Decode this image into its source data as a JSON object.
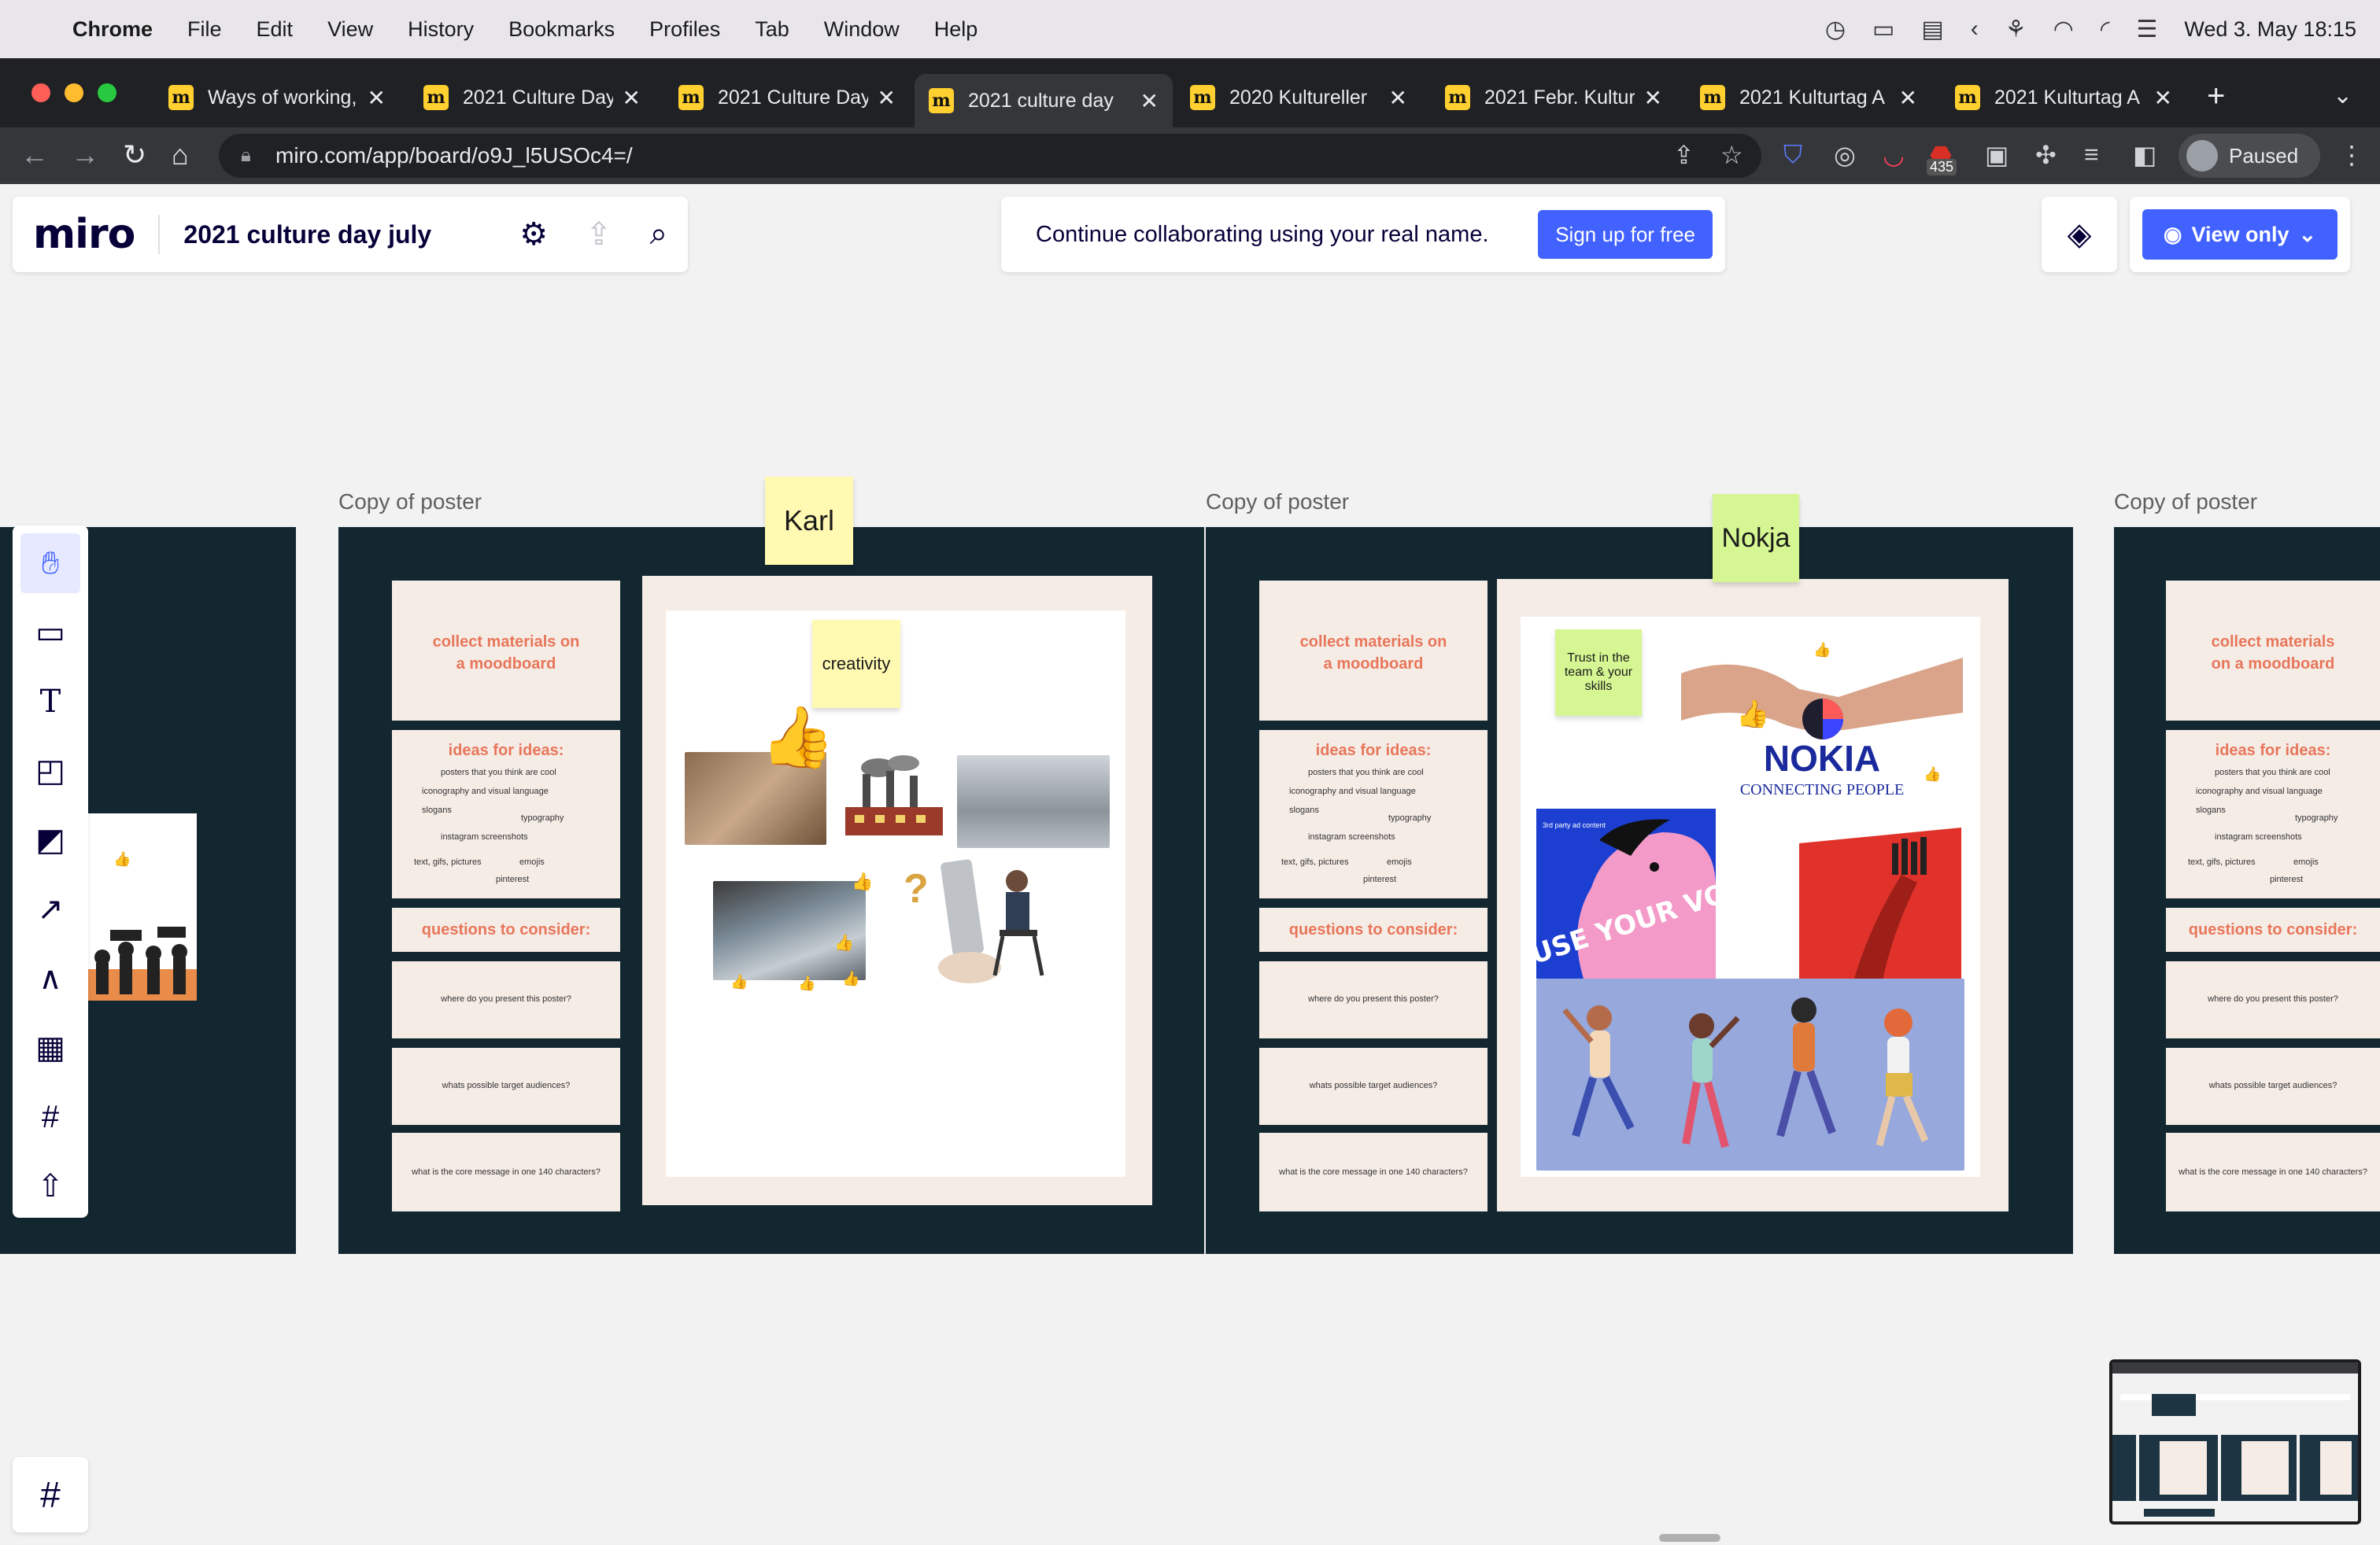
{
  "menubar": {
    "app": "Chrome",
    "items": [
      "File",
      "Edit",
      "View",
      "History",
      "Bookmarks",
      "Profiles",
      "Tab",
      "Window",
      "Help"
    ],
    "datetime": "Wed 3. May  18:15"
  },
  "browser": {
    "tabs": [
      {
        "title": "Ways of working,",
        "active": false
      },
      {
        "title": "2021 Culture Day",
        "active": false
      },
      {
        "title": "2021 Culture Day",
        "active": false
      },
      {
        "title": "2021 culture day",
        "active": true
      },
      {
        "title": "2020 Kultureller",
        "active": false
      },
      {
        "title": "2021 Febr. Kultur",
        "active": false
      },
      {
        "title": "2021 Kulturtag A",
        "active": false
      },
      {
        "title": "2021 Kulturtag A",
        "active": false
      }
    ],
    "url": "miro.com/app/board/o9J_l5USOc4=/",
    "profile_label": "Paused",
    "badge_count": "435"
  },
  "miro": {
    "logo": "miro",
    "board_name": "2021 culture day july",
    "banner_text": "Continue collaborating using your real name.",
    "signup_label": "Sign up for free",
    "view_only_label": "View only"
  },
  "canvas": {
    "frame_label": "Copy of poster",
    "panels": {
      "collect": "collect materials on a moodboard",
      "ideas_title": "ideas for ideas:",
      "ideas_items": [
        "posters that you think are cool",
        "iconography and visual language",
        "slogans",
        "typography",
        "instagram screenshots",
        "text, gifs, pictures",
        "emojis",
        "pinterest"
      ],
      "questions_title": "questions to consider:",
      "q1": "where do you present this poster?",
      "q2": "whats possible target audiences?",
      "q3": "what is the core message in one 140 characters?"
    },
    "stickies": {
      "karl": "Karl",
      "creativity": "creativity",
      "nokja": "Nokja",
      "trust": "Trust in the team & your skills"
    },
    "nokia": {
      "brand": "NOKIA",
      "tagline": "CONNECTING PEOPLE",
      "voice": "USE YOUR VOICE",
      "caption": "3rd party ad content"
    },
    "emoji_like": "👍",
    "emoji_question": "?"
  }
}
